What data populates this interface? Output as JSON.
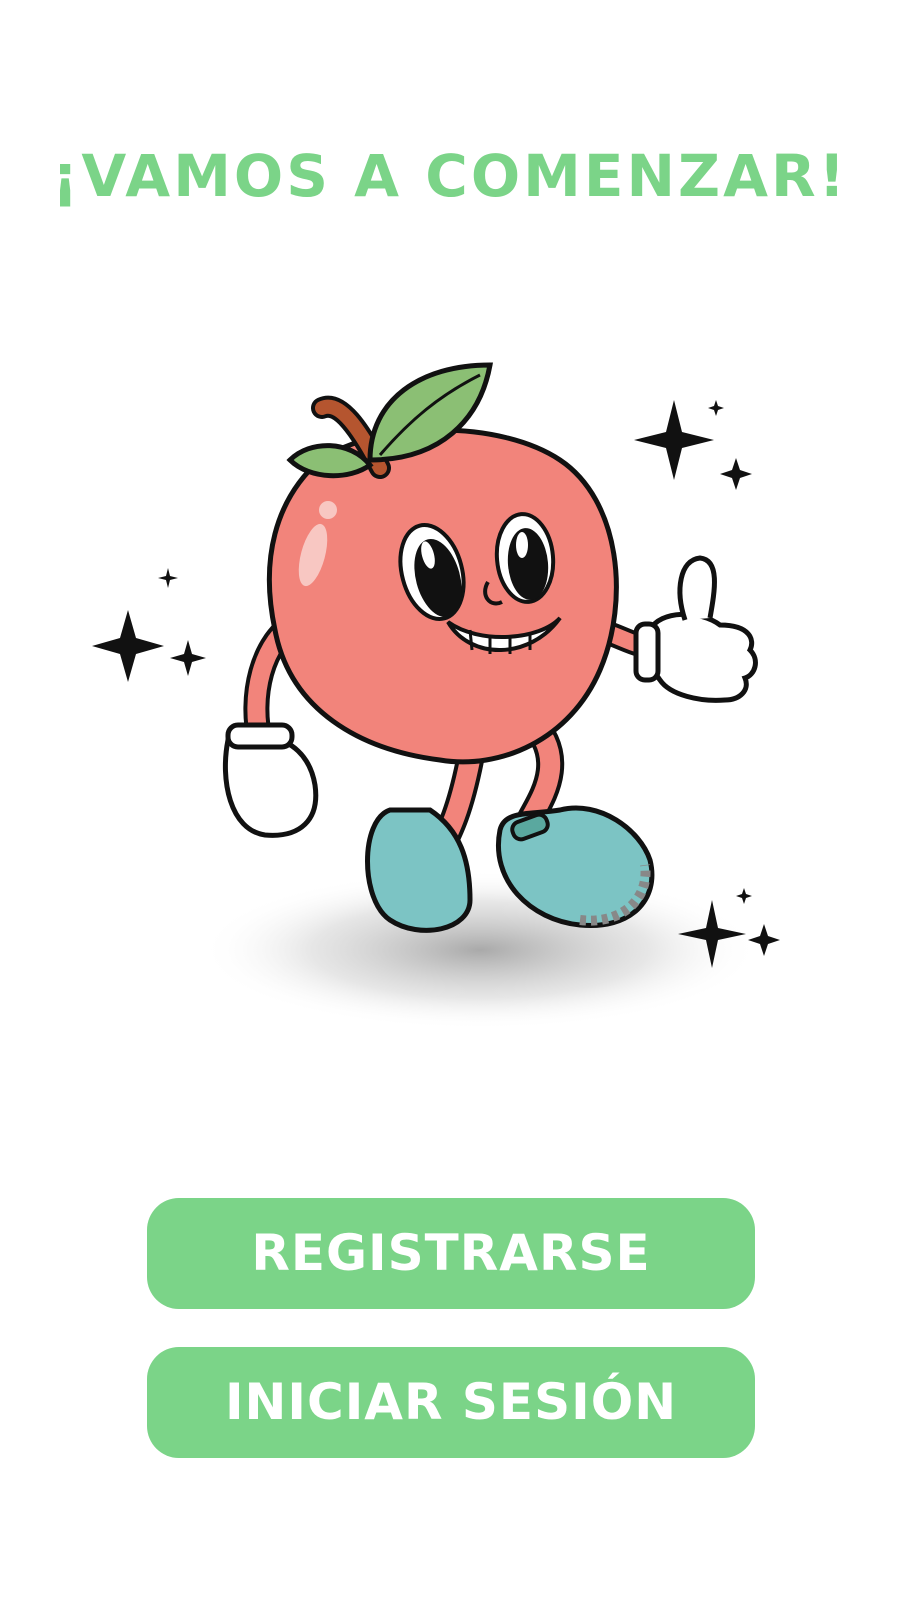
{
  "heading": {
    "text": "¡VAMOS A COMENZAR!"
  },
  "illustration": {
    "subject": "peach-mascot",
    "colors": {
      "peach": "#f2847b",
      "leaf": "#8bbf74",
      "stem": "#b5552f",
      "shoe": "#7cc4c4",
      "sparkle": "#111111"
    }
  },
  "actions": {
    "register_label": "REGISTRARSE",
    "login_label": "INICIAR SESIÓN"
  },
  "theme": {
    "accent": "#7bd488",
    "button_text": "#ffffff",
    "background": "#ffffff"
  }
}
